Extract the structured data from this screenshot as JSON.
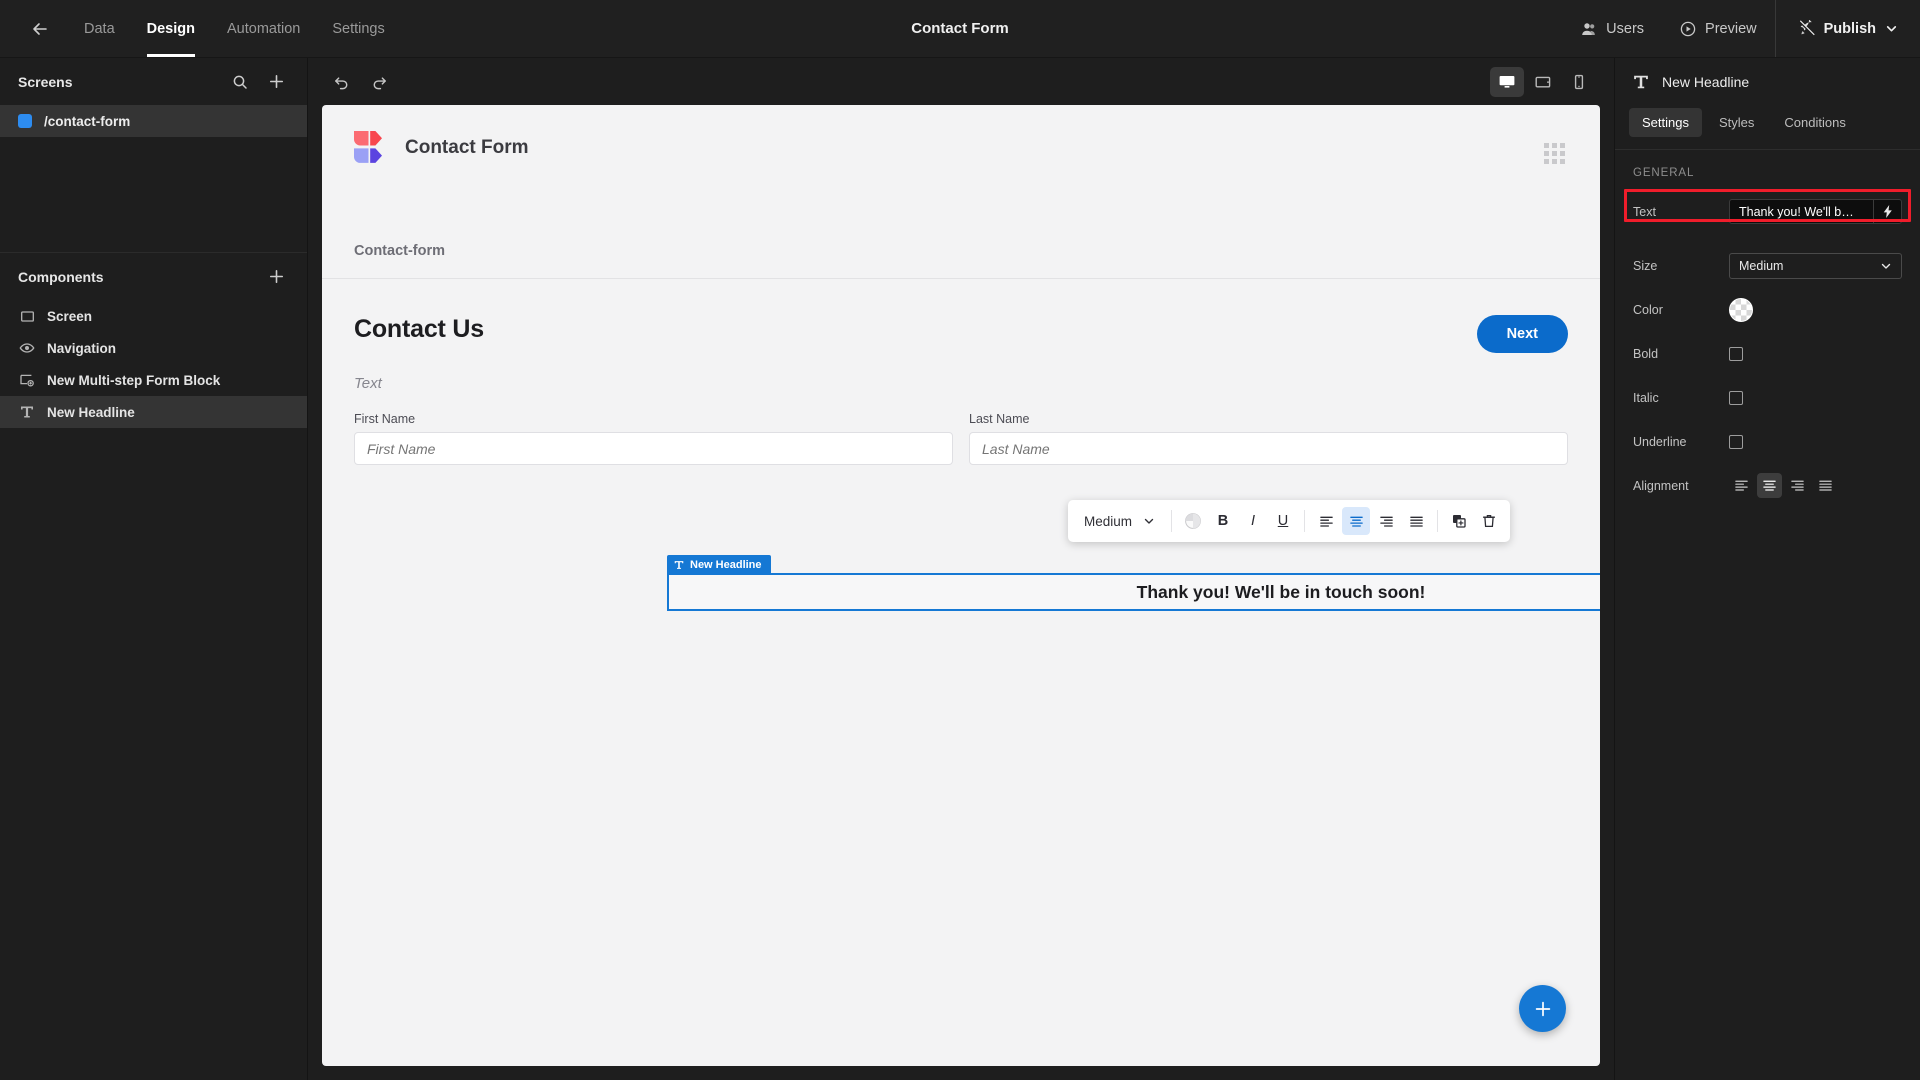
{
  "topbar": {
    "back_icon": "arrow-left-icon",
    "tabs": [
      {
        "label": "Data",
        "active": false
      },
      {
        "label": "Design",
        "active": true
      },
      {
        "label": "Automation",
        "active": false
      },
      {
        "label": "Settings",
        "active": false
      }
    ],
    "app_title": "Contact Form",
    "users_label": "Users",
    "preview_label": "Preview",
    "publish_label": "Publish"
  },
  "left_panel": {
    "screens": {
      "title": "Screens",
      "search_icon": "search-icon",
      "add_icon": "plus-icon",
      "items": [
        {
          "label": "/contact-form",
          "selected": true,
          "color": "#2d8cf0"
        }
      ]
    },
    "components": {
      "title": "Components",
      "add_icon": "plus-icon",
      "items": [
        {
          "label": "Screen",
          "icon": "screen-icon",
          "selected": false
        },
        {
          "label": "Navigation",
          "icon": "eye-icon",
          "selected": false
        },
        {
          "label": "New Multi-step Form Block",
          "icon": "form-block-icon",
          "selected": false
        },
        {
          "label": "New Headline",
          "icon": "text-t-icon",
          "selected": true
        }
      ]
    }
  },
  "canvas_toolbar": {
    "undo_icon": "undo-icon",
    "redo_icon": "redo-icon",
    "devices": [
      {
        "name": "desktop-icon",
        "active": true
      },
      {
        "name": "tablet-icon",
        "active": false
      },
      {
        "name": "mobile-icon",
        "active": false
      }
    ]
  },
  "canvas": {
    "brand_name": "Contact Form",
    "grid_icon": "grid-dots-icon",
    "subnav_link": "Contact-form",
    "form": {
      "title": "Contact Us",
      "next_button": "Next",
      "subtext": "Text",
      "fields": [
        {
          "label": "First Name",
          "placeholder": "First Name"
        },
        {
          "label": "Last Name",
          "placeholder": "Last Name"
        }
      ]
    },
    "rich_text_toolbar": {
      "size_value": "Medium",
      "chevron_icon": "chevron-down-icon",
      "color_icon": "color-wheel-icon",
      "bold_label": "B",
      "italic_label": "I",
      "underline_label": "U",
      "align_left_icon": "align-left-icon",
      "align_center_icon": "align-center-icon",
      "align_right_icon": "align-right-icon",
      "align_justify_icon": "align-justify-icon",
      "duplicate_icon": "duplicate-icon",
      "delete_icon": "trash-icon"
    },
    "selected_block": {
      "badge_label": "New Headline",
      "badge_icon": "text-t-icon",
      "text": "Thank you! We'll be in touch soon!",
      "outline_color": "#1578d4"
    },
    "fab_icon": "plus-icon"
  },
  "right_panel": {
    "component_icon": "text-t-icon",
    "component_name": "New Headline",
    "tabs": [
      {
        "label": "Settings",
        "active": true
      },
      {
        "label": "Styles",
        "active": false
      },
      {
        "label": "Conditions",
        "active": false
      }
    ],
    "section_title": "GENERAL",
    "highlight_color": "#f01d2b",
    "rows": {
      "text": {
        "label": "Text",
        "value": "Thank you! We'll b…",
        "binding_icon": "lightning-bolt-icon"
      },
      "size": {
        "label": "Size",
        "value": "Medium",
        "chevron_icon": "chevron-down-icon"
      },
      "color": {
        "label": "Color",
        "swatch": "transparent-checker"
      },
      "bold": {
        "label": "Bold",
        "checked": false
      },
      "italic": {
        "label": "Italic",
        "checked": false
      },
      "underline": {
        "label": "Underline",
        "checked": false
      },
      "alignment": {
        "label": "Alignment",
        "options": [
          {
            "name": "align-left-icon",
            "active": false
          },
          {
            "name": "align-center-icon",
            "active": true
          },
          {
            "name": "align-right-icon",
            "active": false
          },
          {
            "name": "align-justify-icon",
            "active": false
          }
        ]
      }
    }
  }
}
